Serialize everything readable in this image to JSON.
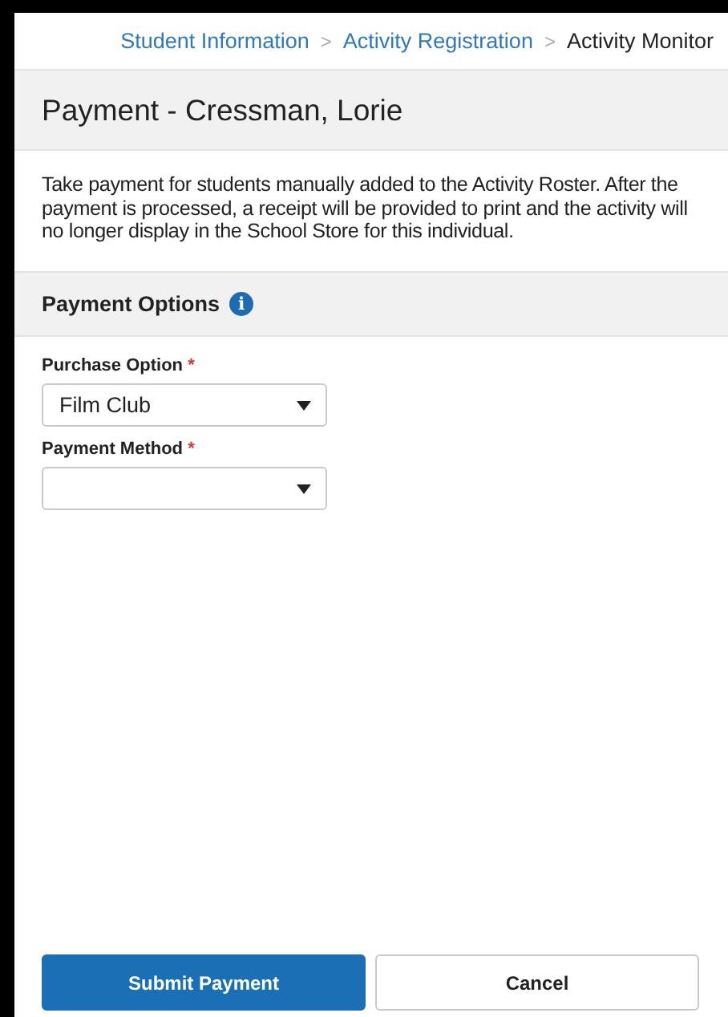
{
  "breadcrumb": [
    {
      "label": "Student Information",
      "link": true
    },
    {
      "label": "Activity Registration",
      "link": true
    },
    {
      "label": "Activity Monitor",
      "link": false
    }
  ],
  "breadcrumb_separator": ">",
  "title": "Payment - Cressman, Lorie",
  "description": "Take payment for students manually added to the Activity Roster. After the payment is processed, a receipt will be provided to print and the activity will no longer display in the School Store for this individual.",
  "section": {
    "title": "Payment Options",
    "info_icon": "i"
  },
  "fields": [
    {
      "label": "Purchase Option",
      "required_mark": "*",
      "value": "Film Club"
    },
    {
      "label": "Payment Method",
      "required_mark": "*"
    }
  ],
  "buttons": [
    {
      "label": "Submit Payment",
      "kind": "primary"
    },
    {
      "label": "Cancel",
      "kind": "secondary"
    }
  ]
}
